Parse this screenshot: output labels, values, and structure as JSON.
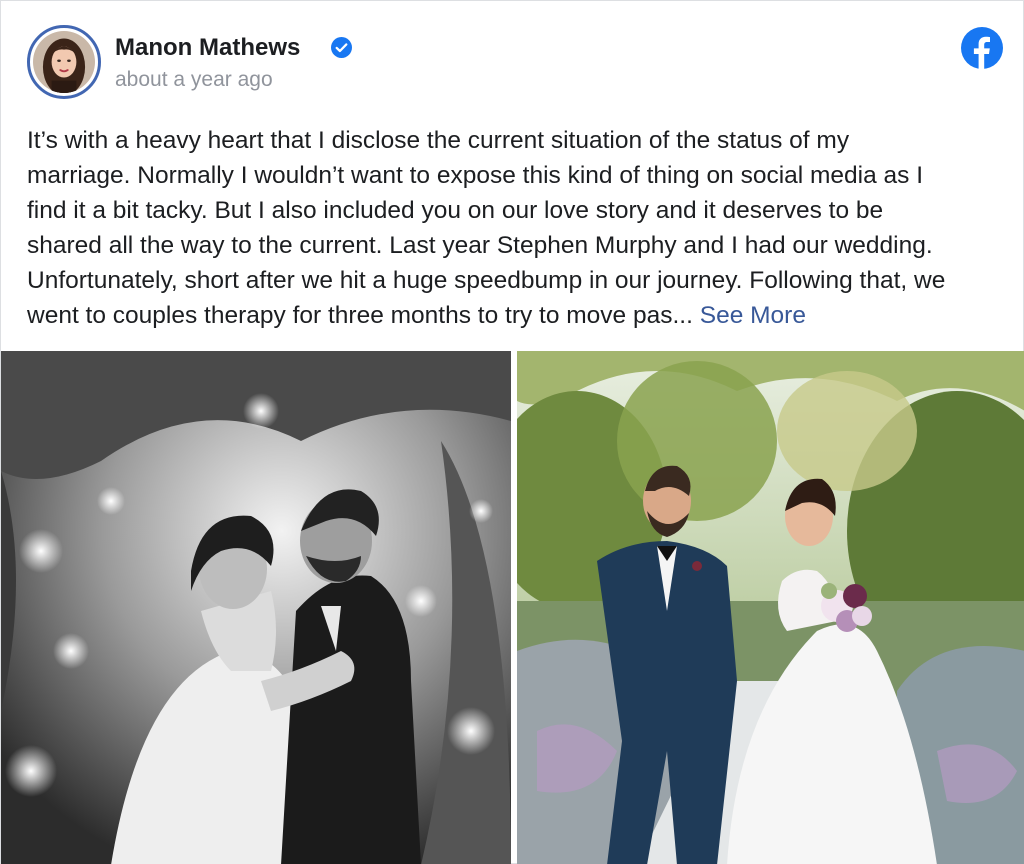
{
  "post": {
    "author_name": "Manon Mathews",
    "timestamp": "about a year ago",
    "text_lines": [
      "It’s with a heavy heart that I disclose the current situation of the status of my",
      "marriage. Normally I wouldn’t want to expose this kind of thing on social media as I",
      "find it a bit tacky. But I also included you on our love story and it deserves to be",
      "shared all the way to the current. Last year Stephen Murphy and I had our wedding.",
      "Unfortunately, short after we hit a huge speedbump in our journey. Following that, we",
      "went to couples therapy for three months to try to move pas... "
    ],
    "see_more_label": "See More"
  },
  "icons": {
    "verified": "verified-badge-icon",
    "brand": "facebook-logo-icon"
  },
  "colors": {
    "brand_blue": "#1877f2",
    "avatar_ring": "#4267b2",
    "link": "#385898",
    "timestamp_gray": "#90949c",
    "text": "#1c1e21"
  }
}
